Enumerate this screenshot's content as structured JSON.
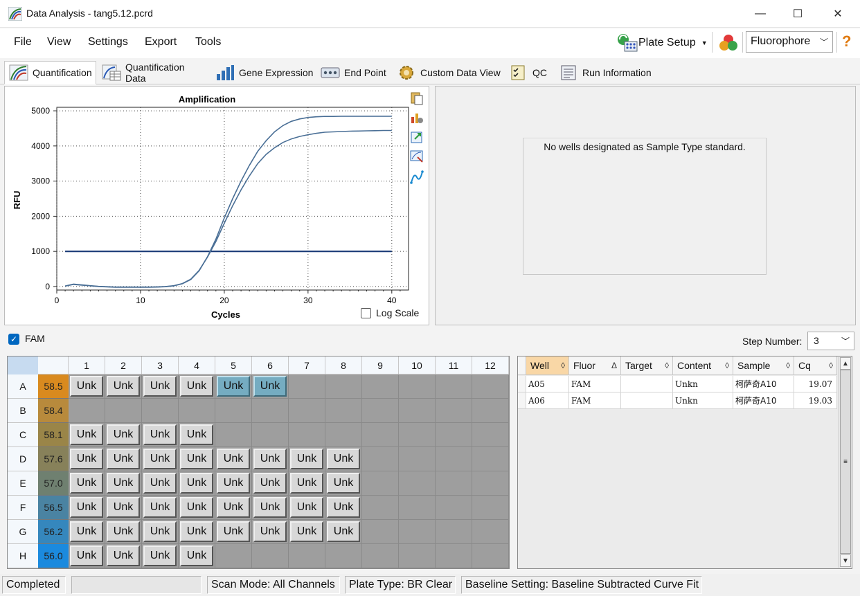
{
  "window": {
    "title": "Data Analysis - tang5.12.pcrd",
    "minimize_glyph": "—",
    "maximize_glyph": "☐",
    "close_glyph": "✕"
  },
  "menu": {
    "file": "File",
    "view": "View",
    "settings": "Settings",
    "export": "Export",
    "tools": "Tools",
    "plate_setup": "Plate Setup",
    "fluorophore": "Fluorophore",
    "help_glyph": "?"
  },
  "tabs": [
    {
      "label": "Quantification",
      "icon": "quantification-icon"
    },
    {
      "label": "Quantification Data",
      "icon": "quantification-data-icon"
    },
    {
      "label": "Gene Expression",
      "icon": "gene-expression-icon"
    },
    {
      "label": "End Point",
      "icon": "end-point-icon"
    },
    {
      "label": "Custom Data View",
      "icon": "custom-data-view-icon"
    },
    {
      "label": "QC",
      "icon": "qc-icon"
    },
    {
      "label": "Run Information",
      "icon": "run-information-icon"
    }
  ],
  "chart_data": {
    "type": "line",
    "title": "Amplification",
    "xlabel": "Cycles",
    "ylabel": "RFU",
    "xlim": [
      0,
      42
    ],
    "ylim": [
      -100,
      5100
    ],
    "xticks": [
      "0",
      "10",
      "20",
      "30",
      "40"
    ],
    "yticks": [
      "0",
      "1000",
      "2000",
      "3000",
      "4000",
      "5000"
    ],
    "grid": true,
    "threshold": 1000,
    "series": [
      {
        "x": [
          1,
          2,
          3,
          4,
          5,
          6,
          7,
          8,
          9,
          10,
          11,
          12,
          13,
          14,
          15,
          16,
          17,
          18,
          19,
          20,
          21,
          22,
          23,
          24,
          25,
          26,
          27,
          28,
          29,
          30,
          31,
          32,
          33,
          34,
          35,
          36,
          37,
          38,
          39,
          40
        ],
        "values": [
          10,
          60,
          40,
          20,
          0,
          -10,
          -20,
          -20,
          -20,
          -20,
          -20,
          -15,
          -5,
          20,
          80,
          200,
          450,
          850,
          1350,
          1950,
          2500,
          3000,
          3450,
          3850,
          4150,
          4400,
          4580,
          4700,
          4770,
          4810,
          4830,
          4840,
          4840,
          4845,
          4845,
          4845,
          4845,
          4845,
          4845,
          4845
        ]
      },
      {
        "x": [
          1,
          2,
          3,
          4,
          5,
          6,
          7,
          8,
          9,
          10,
          11,
          12,
          13,
          14,
          15,
          16,
          17,
          18,
          19,
          20,
          21,
          22,
          23,
          24,
          25,
          26,
          27,
          28,
          29,
          30,
          31,
          32,
          33,
          34,
          35,
          36,
          37,
          38,
          39,
          40
        ],
        "values": [
          15,
          70,
          45,
          25,
          5,
          -5,
          -15,
          -15,
          -15,
          -15,
          -15,
          -10,
          0,
          25,
          85,
          210,
          460,
          840,
          1280,
          1800,
          2300,
          2750,
          3150,
          3500,
          3760,
          3950,
          4100,
          4200,
          4270,
          4320,
          4360,
          4390,
          4400,
          4410,
          4420,
          4425,
          4430,
          4435,
          4440,
          4440
        ]
      }
    ]
  },
  "chart_options": {
    "log_scale_label": "Log Scale",
    "log_scale_checked": false
  },
  "standard_message": "No wells designated as Sample Type standard.",
  "fam": {
    "label": "FAM",
    "checked": true
  },
  "step": {
    "label": "Step Number:",
    "value": "3"
  },
  "plate": {
    "columns": [
      "1",
      "2",
      "3",
      "4",
      "5",
      "6",
      "7",
      "8",
      "9",
      "10",
      "11",
      "12"
    ],
    "rows": [
      {
        "row": "A",
        "temp": "58.5",
        "color": "#d98a1f",
        "wells": 6,
        "selected": [
          5,
          6
        ]
      },
      {
        "row": "B",
        "temp": "58.4",
        "color": "#b88a3c",
        "wells": 0,
        "selected": []
      },
      {
        "row": "C",
        "temp": "58.1",
        "color": "#9a8548",
        "wells": 4,
        "selected": []
      },
      {
        "row": "D",
        "temp": "57.6",
        "color": "#87815a",
        "wells": 8,
        "selected": []
      },
      {
        "row": "E",
        "temp": "57.0",
        "color": "#6f8070",
        "wells": 8,
        "selected": []
      },
      {
        "row": "F",
        "temp": "56.5",
        "color": "#4a83a2",
        "wells": 8,
        "selected": []
      },
      {
        "row": "G",
        "temp": "56.2",
        "color": "#3587bd",
        "wells": 8,
        "selected": []
      },
      {
        "row": "H",
        "temp": "56.0",
        "color": "#1b8ade",
        "wells": 4,
        "selected": []
      }
    ],
    "well_label": "Unk"
  },
  "table": {
    "headers": [
      {
        "label": "Well",
        "sort": "◊"
      },
      {
        "label": "Fluor",
        "sort": "Δ"
      },
      {
        "label": "Target",
        "sort": "◊"
      },
      {
        "label": "Content",
        "sort": "◊"
      },
      {
        "label": "Sample",
        "sort": "◊"
      },
      {
        "label": "Cq",
        "sort": "◊"
      }
    ],
    "rows": [
      [
        "A05",
        "FAM",
        "",
        "Unkn",
        "柯萨奇A10",
        "19.07"
      ],
      [
        "A06",
        "FAM",
        "",
        "Unkn",
        "柯萨奇A10",
        "19.03"
      ]
    ]
  },
  "status": {
    "state": "Completed",
    "scan_mode": "Scan Mode: All Channels",
    "plate_type": "Plate Type: BR Clear",
    "baseline": "Baseline Setting: Baseline Subtracted Curve Fit"
  }
}
